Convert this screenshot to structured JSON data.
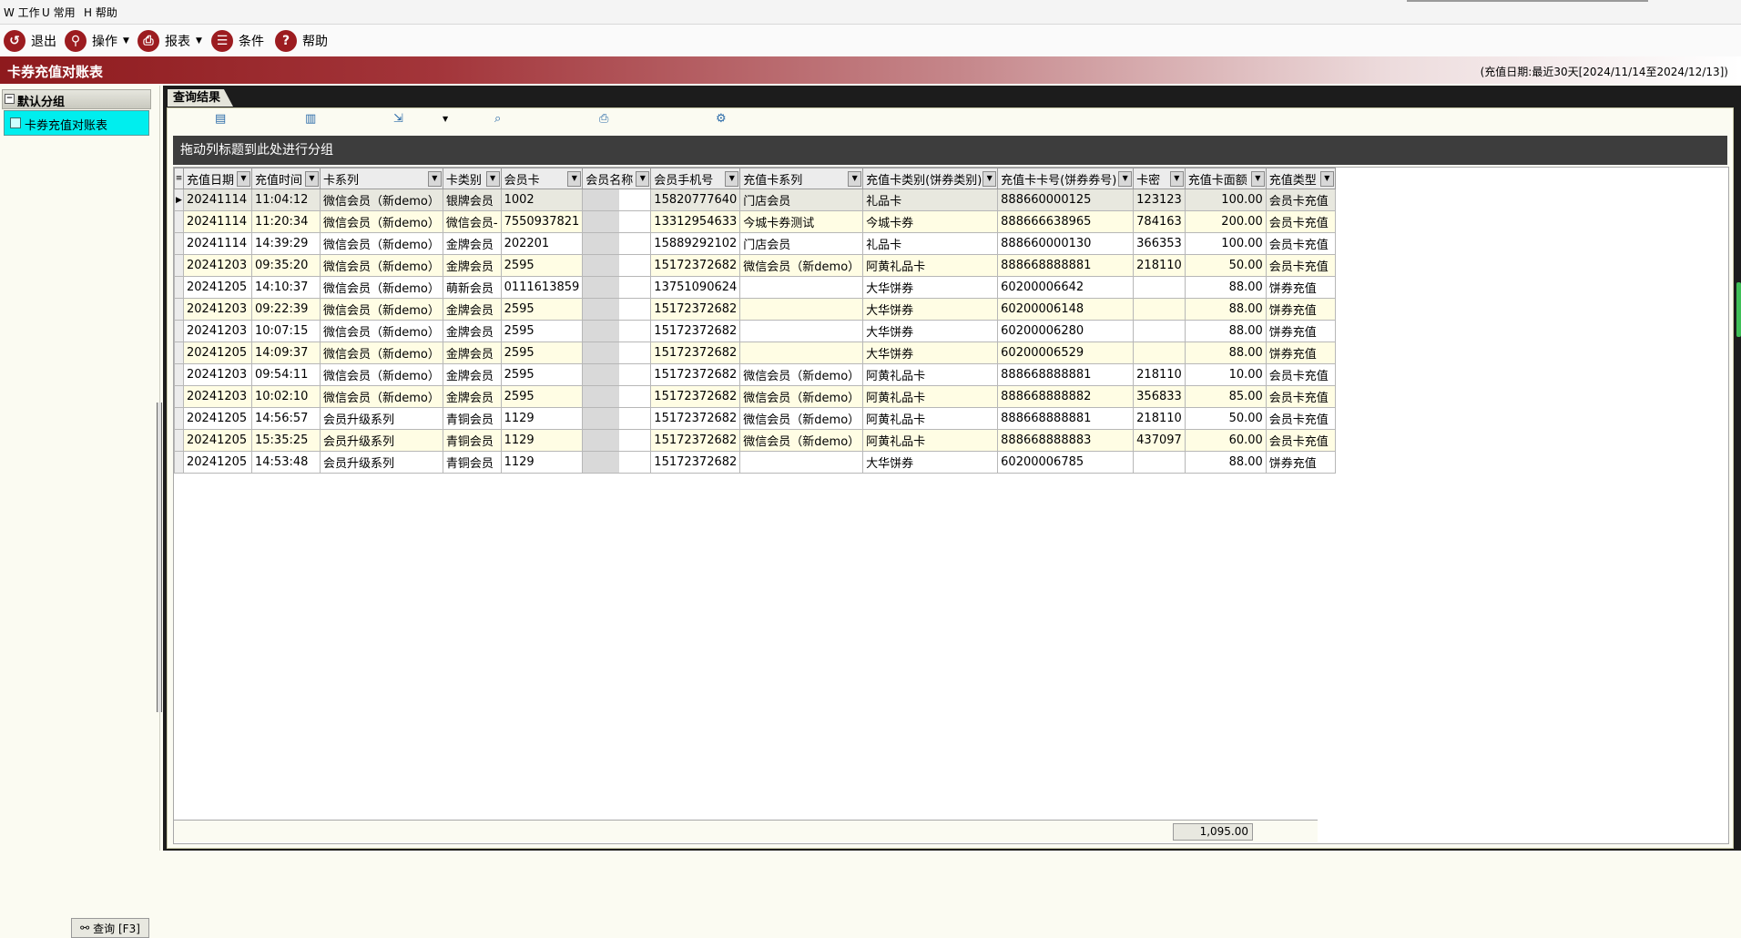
{
  "menu": [
    {
      "key": "W",
      "label": "工作"
    },
    {
      "key": "U",
      "label": "常用"
    },
    {
      "key": "H",
      "label": "帮助"
    }
  ],
  "toolbar": {
    "exit": "退出",
    "operate": "操作",
    "report": "报表",
    "condition": "条件",
    "help": "帮助"
  },
  "window_title": "卡券充值对账表",
  "date_info": "(充值日期:最近30天[2024/11/14至2024/12/13])",
  "left": {
    "group_label": "默认分组",
    "item_label": "卡券充值对账表",
    "query_button": "查询 [F3]"
  },
  "tab_label": "查询结果",
  "group_hint": "拖动列标题到此处进行分组",
  "columns": [
    "充值日期",
    "充值时间",
    "卡系列",
    "卡类别",
    "会员卡",
    "会员名称",
    "会员手机号",
    "充值卡系列",
    "充值卡类别(饼券类别)",
    "充值卡卡号(饼券券号)",
    "卡密",
    "充值卡面额",
    "充值类型"
  ],
  "rows": [
    [
      "20241114",
      "11:04:12",
      "微信会员（新demo）",
      "银牌会员",
      "1002",
      "",
      "15820777640",
      "门店会员",
      "礼品卡",
      "888660000125",
      "123123",
      "100.00",
      "会员卡充值"
    ],
    [
      "20241114",
      "11:20:34",
      "微信会员（新demo）",
      "微信会员-",
      "7550937821",
      "",
      "13312954633",
      "今城卡券测试",
      "今城卡券",
      "888666638965",
      "784163",
      "200.00",
      "会员卡充值"
    ],
    [
      "20241114",
      "14:39:29",
      "微信会员（新demo）",
      "金牌会员",
      "202201",
      "",
      "15889292102",
      "门店会员",
      "礼品卡",
      "888660000130",
      "366353",
      "100.00",
      "会员卡充值"
    ],
    [
      "20241203",
      "09:35:20",
      "微信会员（新demo）",
      "金牌会员",
      "2595",
      "",
      "15172372682",
      "微信会员（新demo）",
      "阿黄礼品卡",
      "888668888881",
      "218110",
      "50.00",
      "会员卡充值"
    ],
    [
      "20241205",
      "14:10:37",
      "微信会员（新demo）",
      "萌新会员",
      "0111613859",
      "",
      "13751090624",
      "",
      "大华饼券",
      "60200006642",
      "",
      "88.00",
      "饼券充值"
    ],
    [
      "20241203",
      "09:22:39",
      "微信会员（新demo）",
      "金牌会员",
      "2595",
      "",
      "15172372682",
      "",
      "大华饼券",
      "60200006148",
      "",
      "88.00",
      "饼券充值"
    ],
    [
      "20241203",
      "10:07:15",
      "微信会员（新demo）",
      "金牌会员",
      "2595",
      "",
      "15172372682",
      "",
      "大华饼券",
      "60200006280",
      "",
      "88.00",
      "饼券充值"
    ],
    [
      "20241205",
      "14:09:37",
      "微信会员（新demo）",
      "金牌会员",
      "2595",
      "",
      "15172372682",
      "",
      "大华饼券",
      "60200006529",
      "",
      "88.00",
      "饼券充值"
    ],
    [
      "20241203",
      "09:54:11",
      "微信会员（新demo）",
      "金牌会员",
      "2595",
      "",
      "15172372682",
      "微信会员（新demo）",
      "阿黄礼品卡",
      "888668888881",
      "218110",
      "10.00",
      "会员卡充值"
    ],
    [
      "20241203",
      "10:02:10",
      "微信会员（新demo）",
      "金牌会员",
      "2595",
      "",
      "15172372682",
      "微信会员（新demo）",
      "阿黄礼品卡",
      "888668888882",
      "356833",
      "85.00",
      "会员卡充值"
    ],
    [
      "20241205",
      "14:56:57",
      "会员升级系列",
      "青铜会员",
      "1129",
      "",
      "15172372682",
      "微信会员（新demo）",
      "阿黄礼品卡",
      "888668888881",
      "218110",
      "50.00",
      "会员卡充值"
    ],
    [
      "20241205",
      "15:35:25",
      "会员升级系列",
      "青铜会员",
      "1129",
      "",
      "15172372682",
      "微信会员（新demo）",
      "阿黄礼品卡",
      "888668888883",
      "437097",
      "60.00",
      "会员卡充值"
    ],
    [
      "20241205",
      "14:53:48",
      "会员升级系列",
      "青铜会员",
      "1129",
      "",
      "15172372682",
      "",
      "大华饼券",
      "60200006785",
      "",
      "88.00",
      "饼券充值"
    ]
  ],
  "total": "1,095.00",
  "colors": {
    "brand": "#9c1c20",
    "selected_group": "#00eeee",
    "row_alt": "#fffde4",
    "group_bar": "#3d3d3d"
  }
}
